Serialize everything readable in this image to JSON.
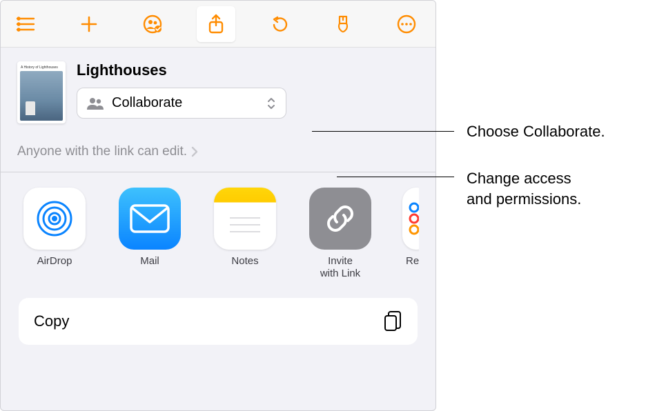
{
  "document": {
    "title": "Lighthouses",
    "thumb_caption": "A History of Lighthouses"
  },
  "collab_dropdown": {
    "label": "Collaborate"
  },
  "access": {
    "text": "Anyone with the link can edit."
  },
  "share_options": {
    "airdrop": "AirDrop",
    "mail": "Mail",
    "notes": "Notes",
    "invite": "Invite\nwith Link",
    "reminders": "Reminders"
  },
  "copy": {
    "label": "Copy"
  },
  "callouts": {
    "c1": "Choose Collaborate.",
    "c2": "Change access\nand permissions."
  }
}
